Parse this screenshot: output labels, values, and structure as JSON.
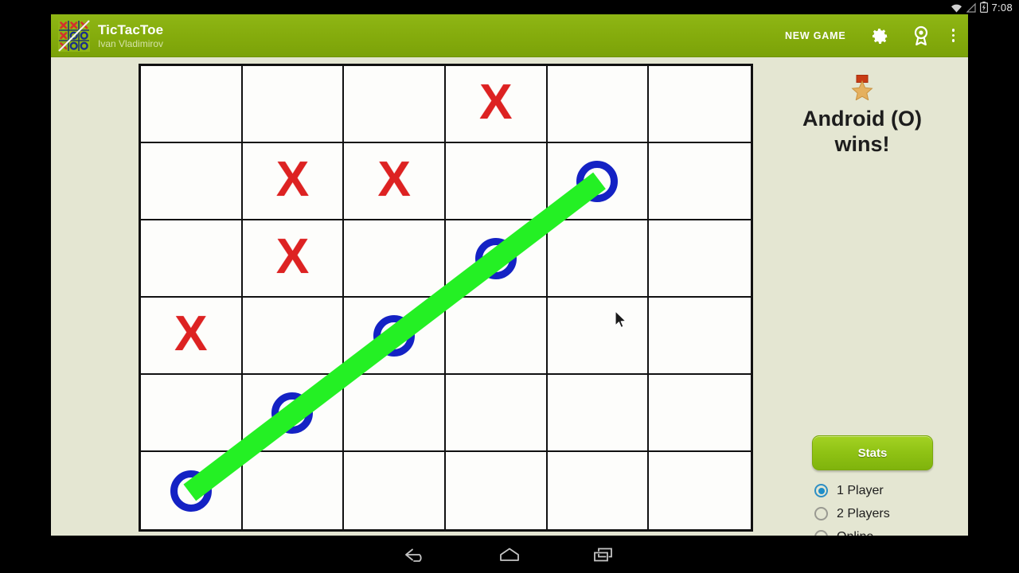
{
  "status_bar": {
    "clock": "7:08",
    "icons": [
      "wifi-icon",
      "signal-icon",
      "battery-charging-icon"
    ]
  },
  "action_bar": {
    "app_icon": "tictactoe-app-icon",
    "title": "TicTacToe",
    "subtitle": "Ivan Vladimirov",
    "new_game_label": "NEW GAME",
    "gear_icon": "gear-icon",
    "award_icon": "award-icon",
    "overflow_icon": "overflow-menu-icon",
    "bar_color": "#84ab0c"
  },
  "board": {
    "rows": 6,
    "cols": 6,
    "cells": [
      [
        "",
        "",
        "",
        "X",
        "",
        ""
      ],
      [
        "",
        "X",
        "X",
        "",
        "O",
        ""
      ],
      [
        "",
        "X",
        "",
        "O",
        "",
        ""
      ],
      [
        "X",
        "",
        "O",
        "",
        "",
        ""
      ],
      [
        "",
        "O",
        "",
        "",
        "",
        ""
      ],
      [
        "O",
        "",
        "",
        "",
        "",
        ""
      ]
    ],
    "x_color": "#dd2222",
    "o_color": "#1422c4",
    "grid_color": "#111111",
    "cell_bg": "#fdfdfb",
    "win_line": {
      "color": "#24f024",
      "from_cell": [
        5,
        0
      ],
      "to_cell": [
        1,
        4
      ]
    }
  },
  "side_panel": {
    "trophy_icon": "star-medal-icon",
    "result_line1": "Android (O)",
    "result_line2": "wins!",
    "stats_label": "Stats",
    "stats_color": "#8fc214",
    "mode_options": [
      {
        "label": "1 Player",
        "selected": true
      },
      {
        "label": "2 Players",
        "selected": false
      },
      {
        "label": "Online",
        "selected": false
      }
    ],
    "selected_radio_color": "#1e8ec9"
  },
  "nav_bar": {
    "back_icon": "back-icon",
    "home_icon": "home-icon",
    "recents_icon": "recents-icon"
  },
  "background": {
    "app_bg": "#e4e6d2",
    "letterbox": "#000000"
  },
  "cursor": "mouse-pointer"
}
